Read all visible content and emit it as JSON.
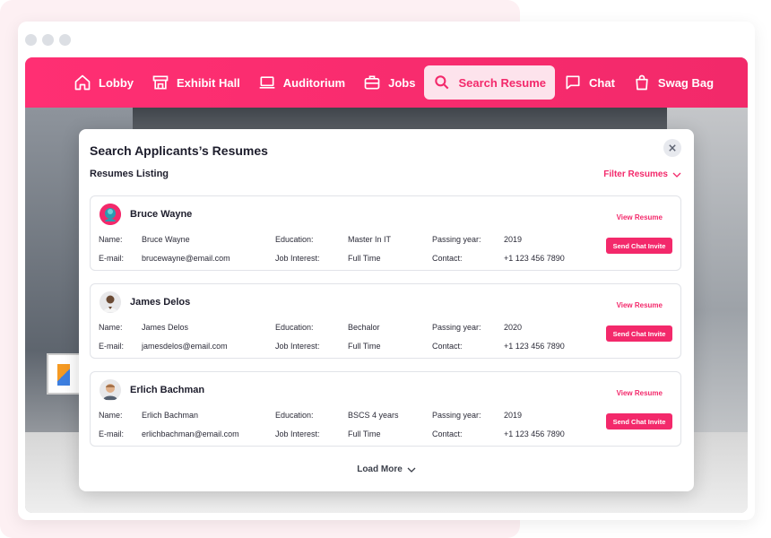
{
  "nav": {
    "items": [
      {
        "label": "Lobby",
        "icon": "home-icon"
      },
      {
        "label": "Exhibit Hall",
        "icon": "storefront-icon"
      },
      {
        "label": "Auditorium",
        "icon": "laptop-icon"
      },
      {
        "label": "Jobs",
        "icon": "briefcase-icon"
      },
      {
        "label": "Search Resume",
        "icon": "search-icon",
        "active": true
      },
      {
        "label": "Chat",
        "icon": "chat-icon"
      },
      {
        "label": "Swag Bag",
        "icon": "shopping-bag-icon"
      }
    ]
  },
  "modal": {
    "title": "Search Applicants’s Resumes",
    "listing_title": "Resumes Listing",
    "filter_label": "Filter Resumes",
    "load_more_label": "Load More"
  },
  "labels": {
    "name": "Name:",
    "email": "E-mail:",
    "education": "Education:",
    "job_interest": "Job Interest:",
    "passing_year": "Passing year:",
    "contact": "Contact:",
    "view_resume": "View Resume",
    "send_invite": "Send Chat Invite"
  },
  "resumes": [
    {
      "name": "Bruce Wayne",
      "email": "brucewayne@email.com",
      "education": "Master In IT",
      "job_interest": "Full Time",
      "passing_year": "2019",
      "contact": "+1 123 456 7890"
    },
    {
      "name": "James Delos",
      "email": "jamesdelos@email.com",
      "education": "Bechalor",
      "job_interest": "Full Time",
      "passing_year": "2020",
      "contact": "+1 123 456 7890"
    },
    {
      "name": "Erlich Bachman",
      "email": "erlichbachman@email.com",
      "education": "BSCS 4 years",
      "job_interest": "Full Time",
      "passing_year": "2019",
      "contact": "+1 123 456 7890"
    }
  ],
  "colors": {
    "accent": "#f3296b",
    "nav_bg": "#ff2f73",
    "active_bg": "#fde3ec"
  }
}
